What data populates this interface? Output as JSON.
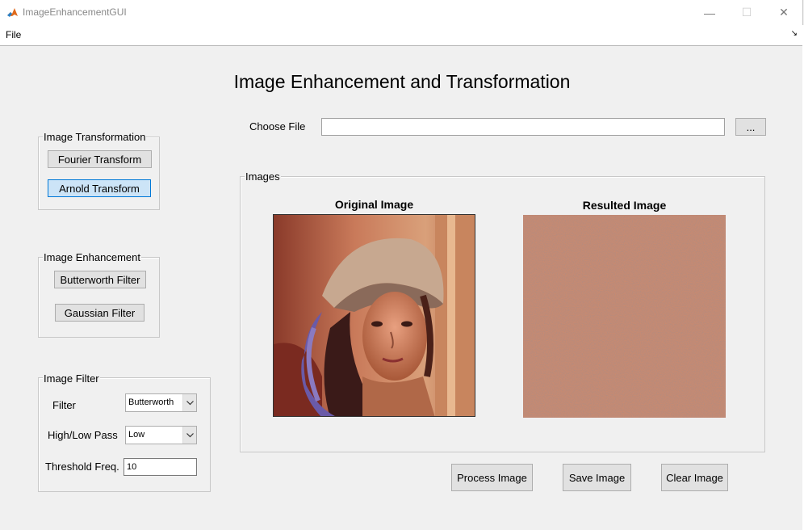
{
  "window": {
    "title": "ImageEnhancementGUI",
    "minimize": "—",
    "maximize": "☐",
    "close": "✕"
  },
  "menu": {
    "file": "File",
    "resize_glyph": "↘"
  },
  "page_title": "Image Enhancement and Transformation",
  "transformation": {
    "legend": "Image Transformation",
    "fourier": "Fourier Transform",
    "arnold": "Arnold Transform"
  },
  "enhancement": {
    "legend": "Image Enhancement",
    "butterworth": "Butterworth Filter",
    "gaussian": "Gaussian Filter"
  },
  "filter": {
    "legend": "Image Filter",
    "filter_label": "Filter",
    "filter_value": "Butterworth",
    "pass_label": "High/Low Pass",
    "pass_value": "Low",
    "threshold_label": "Threshold Freq.",
    "threshold_value": "10"
  },
  "file": {
    "label": "Choose File",
    "value": "",
    "browse": "..."
  },
  "images": {
    "legend": "Images",
    "original_title": "Original Image",
    "result_title": "Resulted Image"
  },
  "actions": {
    "process": "Process Image",
    "save": "Save Image",
    "clear": "Clear Image"
  },
  "icons": {
    "app": "matlab-logo-icon",
    "dropdown": "chevron-down-icon"
  }
}
